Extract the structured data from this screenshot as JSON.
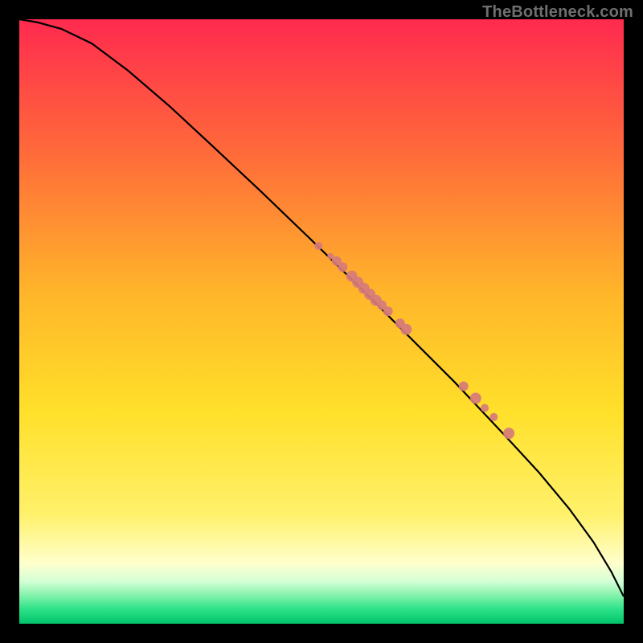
{
  "watermark": "TheBottleneck.com",
  "colors": {
    "bg": "#000000",
    "watermark": "#6f6f6f",
    "curve": "#000000",
    "dot": "#d67b7b",
    "grad_top": "#ff2a4f",
    "grad_mid_upper": "#ff8a2a",
    "grad_mid": "#ffd72a",
    "grad_mid_lower": "#fff16b",
    "grad_pale": "#ffffcc",
    "grad_green1": "#a9f3b0",
    "grad_green2": "#2fe38a",
    "grad_green3": "#00c46b"
  },
  "chart_data": {
    "type": "line",
    "title": "",
    "xlabel": "",
    "ylabel": "",
    "xlim": [
      0,
      100
    ],
    "ylim": [
      0,
      100
    ],
    "grid": false,
    "legend": false,
    "series": [
      {
        "name": "curve",
        "x": [
          0,
          3,
          7,
          12,
          18,
          25,
          32,
          40,
          48,
          56,
          64,
          72,
          80,
          86,
          91,
          95,
          98,
          100
        ],
        "y": [
          100,
          99.5,
          98.4,
          96,
          91.5,
          85.5,
          79,
          71.5,
          63.8,
          56,
          48,
          40,
          31.5,
          25,
          19,
          13.5,
          8.5,
          4.5
        ]
      }
    ],
    "markers": {
      "name": "cluster",
      "x": [
        49.5,
        51.5,
        52.5,
        53.5,
        55.0,
        56.0,
        57.0,
        58.0,
        59.0,
        60.0,
        61.0,
        63.0,
        64.0,
        73.5,
        75.5,
        77.0,
        78.5,
        81.0
      ],
      "y": [
        62.5,
        60.8,
        60.0,
        59.0,
        57.5,
        56.5,
        55.5,
        54.5,
        53.5,
        52.7,
        51.7,
        49.7,
        48.7,
        39.3,
        37.3,
        35.7,
        34.2,
        31.5
      ],
      "r": [
        5,
        4,
        6,
        6,
        7,
        7,
        7,
        7,
        7,
        6,
        6,
        6,
        7,
        6,
        7,
        5,
        5,
        7
      ]
    }
  }
}
